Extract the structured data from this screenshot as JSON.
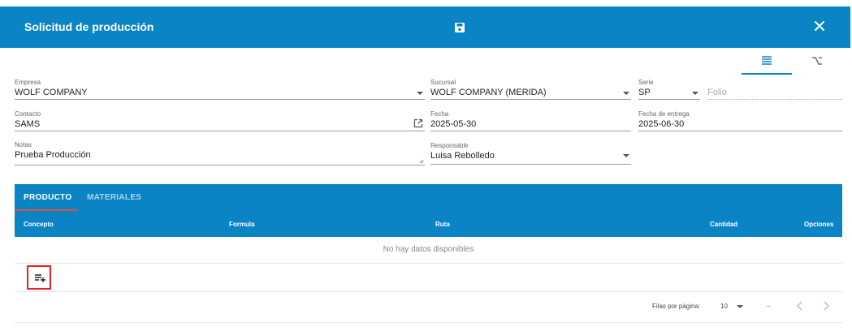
{
  "dialog": {
    "title": "Solicitud de producción",
    "save_icon": "save-icon",
    "close_icon": "close-icon"
  },
  "view_tabs": {
    "form_icon": "list-lines-icon",
    "alt_icon": "option-key-icon"
  },
  "form": {
    "empresa": {
      "label": "Empresa",
      "value": "WOLF COMPANY"
    },
    "sucursal": {
      "label": "Sucursal",
      "value": "WOLF COMPANY (MERIDA)"
    },
    "serie": {
      "label": "Serie",
      "value": "SP"
    },
    "folio": {
      "placeholder": "Folio"
    },
    "contacto": {
      "label": "Contacto",
      "value": "SAMS"
    },
    "fecha": {
      "label": "Fecha",
      "value": "2025-05-30"
    },
    "fecha_entrega": {
      "label": "Fecha de entrega",
      "value": "2025-06-30"
    },
    "notas": {
      "label": "Notas",
      "value": "Prueba Producción"
    },
    "responsable": {
      "label": "Responsable",
      "value": "Luisa Rebolledo"
    }
  },
  "tabs": [
    {
      "label": "PRODUCTO",
      "active": true
    },
    {
      "label": "MATERIALES",
      "active": false
    }
  ],
  "table": {
    "columns": [
      "Concepto",
      "Formula",
      "Ruta",
      "Cantidad",
      "Opciones"
    ],
    "empty_text": "No hay datos disponibles",
    "add_icon": "playlist-add-icon"
  },
  "pagination": {
    "rows_per_page_label": "Filas por página:",
    "rows_per_page": "10",
    "range": "–"
  },
  "colors": {
    "primary": "#0b84c6",
    "highlight": "#e0232a",
    "tab_indicator": "#e0503a"
  }
}
